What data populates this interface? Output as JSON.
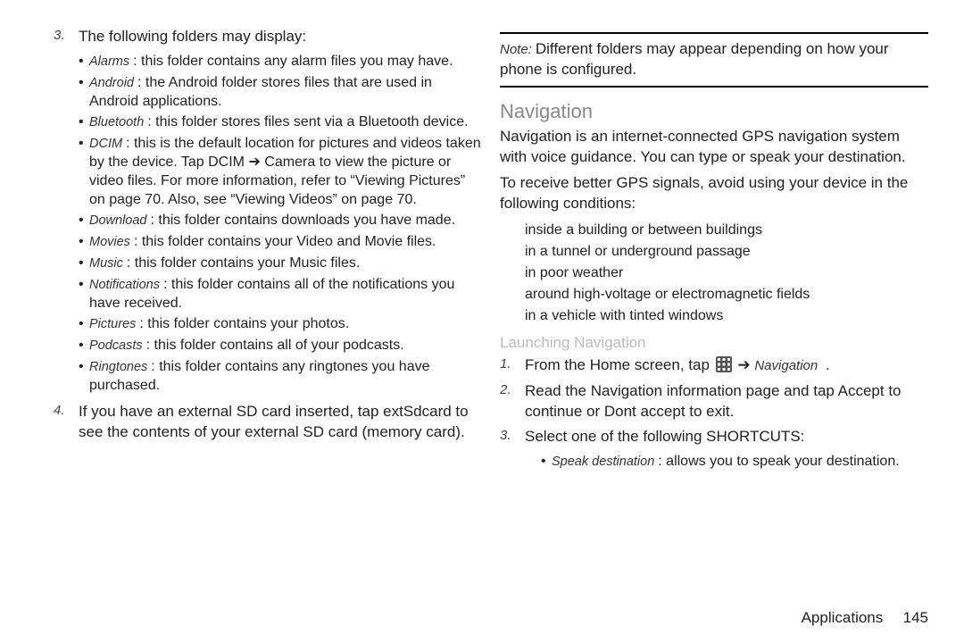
{
  "left": {
    "item3": {
      "num": "3.",
      "lead": "The following folders may display:",
      "folders": [
        {
          "term": "Alarms",
          "desc": ": this folder contains any alarm files you may have."
        },
        {
          "term": "Android",
          "desc": ": the Android folder stores files that are used in Android applications."
        },
        {
          "term": "Bluetooth",
          "desc": ": this folder stores files sent via a Bluetooth device."
        },
        {
          "term": "DCIM",
          "desc": ": this is the default location for pictures and videos taken by the device. Tap DCIM ➔ Camera to view the picture or video files. For more information, refer to “Viewing Pictures” on page 70. Also, see “Viewing Videos” on page 70."
        },
        {
          "term": "Download",
          "desc": ": this folder contains downloads you have made."
        },
        {
          "term": "Movies",
          "desc": ": this folder contains your Video and Movie files."
        },
        {
          "term": "Music",
          "desc": ": this folder contains your Music files."
        },
        {
          "term": "Notifications",
          "desc": ": this folder contains all of the notifications you have received."
        },
        {
          "term": "Pictures",
          "desc": ": this folder contains your photos."
        },
        {
          "term": "Podcasts",
          "desc": ": this folder contains all of your podcasts."
        },
        {
          "term": "Ringtones",
          "desc": ": this folder contains any ringtones you have purchased."
        }
      ]
    },
    "item4": {
      "num": "4.",
      "text": "If you have an external SD card inserted, tap extSdcard to see the contents of your external SD card (memory card)."
    }
  },
  "right": {
    "note": {
      "label": "Note:",
      "text": "Different folders may appear depending on how your phone is configured."
    },
    "nav_heading": "Navigation",
    "nav_para1": "Navigation is an internet-connected GPS navigation system with voice guidance. You can type or speak your destination.",
    "nav_para2": "To receive better GPS signals, avoid using your device in the following conditions:",
    "conditions": [
      "inside a building or between buildings",
      "in a tunnel or underground passage",
      "in poor weather",
      "around high-voltage or electromagnetic fields",
      "in a vehicle with tinted windows"
    ],
    "launch_heading": "Launching Navigation",
    "steps": {
      "s1": {
        "num": "1.",
        "pre": "From the Home screen, tap ",
        "arrow": " ➔ ",
        "app": "Navigation",
        "period": "."
      },
      "s2": {
        "num": "2.",
        "text": "Read the Navigation information page and tap Accept to continue or Dont accept to exit."
      },
      "s3": {
        "num": "3.",
        "text": "Select one of the following SHORTCUTS:"
      }
    },
    "speak": {
      "term": "Speak destination",
      "desc": ": allows you to speak your destination."
    }
  },
  "footer": {
    "section": "Applications",
    "page": "145"
  }
}
